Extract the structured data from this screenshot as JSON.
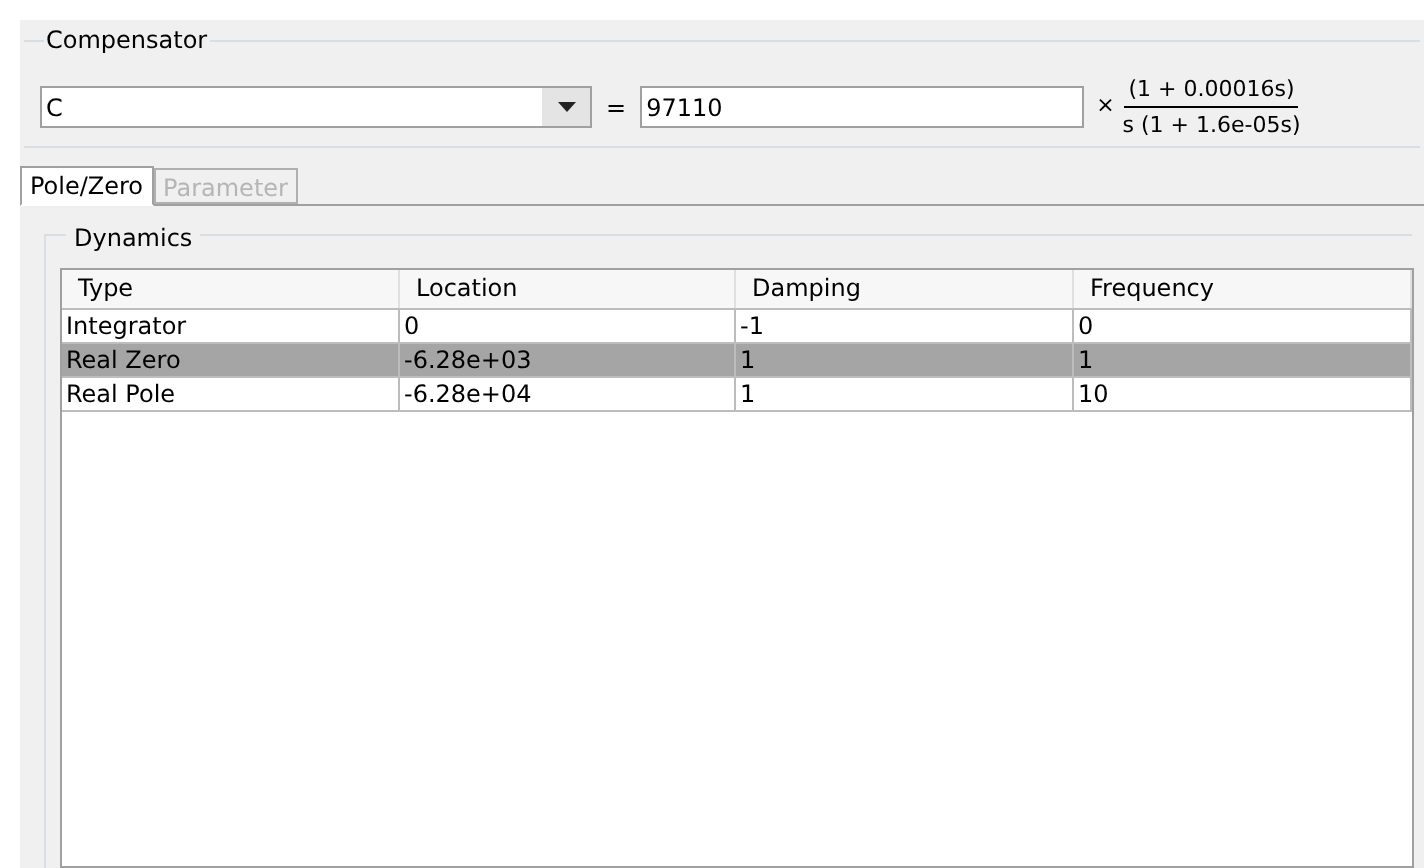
{
  "compensator": {
    "title": "Compensator",
    "name": "C",
    "equals": "=",
    "gain": "97110",
    "times": "×",
    "numerator": "(1 + 0.00016s)",
    "denominator": "s (1 + 1.6e-05s)"
  },
  "tabs": [
    {
      "label": "Pole/Zero",
      "selected": true,
      "disabled": false
    },
    {
      "label": "Parameter",
      "selected": false,
      "disabled": true
    }
  ],
  "dynamics": {
    "title": "Dynamics",
    "columns": [
      "Type",
      "Location",
      "Damping",
      "Frequency"
    ],
    "rows": [
      {
        "cells": [
          "Integrator",
          "0",
          "-1",
          "0"
        ],
        "selected": false
      },
      {
        "cells": [
          "Real Zero",
          "-6.28e+03",
          "1",
          "1"
        ],
        "selected": true
      },
      {
        "cells": [
          "Real Pole",
          "-6.28e+04",
          "1",
          "10"
        ],
        "selected": false
      }
    ]
  }
}
